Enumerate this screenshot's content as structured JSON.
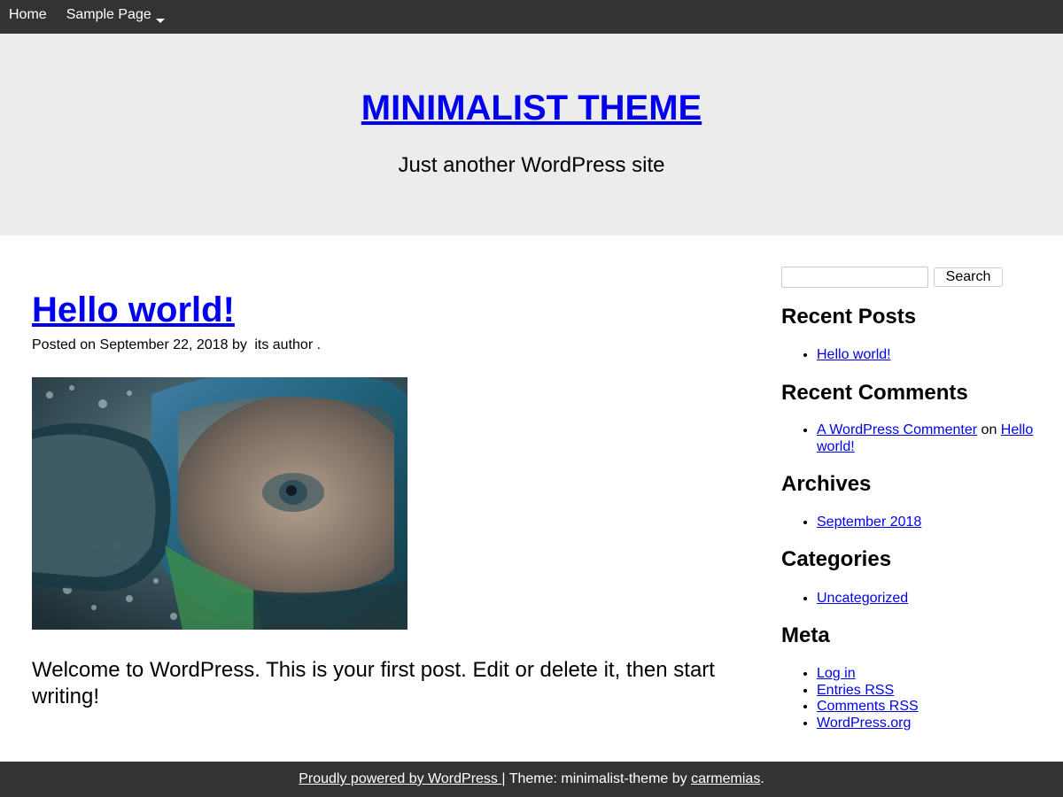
{
  "nav": {
    "items": [
      {
        "label": "Home"
      },
      {
        "label": "Sample Page",
        "has_dropdown": true
      }
    ]
  },
  "header": {
    "title": "MINIMALIST THEME",
    "description": "Just another WordPress site"
  },
  "post": {
    "title": "Hello world!",
    "meta_prefix": "Posted on",
    "date": "September 22, 2018",
    "by": "by",
    "author": "its author",
    "meta_suffix": ".",
    "content": "Welcome to WordPress. This is your first post. Edit or delete it, then start writing!"
  },
  "sidebar": {
    "search": {
      "placeholder": "",
      "button_label": "Search"
    },
    "recent_posts": {
      "title": "Recent Posts",
      "items": [
        "Hello world!"
      ]
    },
    "recent_comments": {
      "title": "Recent Comments",
      "commenter": "A WordPress Commenter",
      "on": "on",
      "post": "Hello world!"
    },
    "archives": {
      "title": "Archives",
      "items": [
        "September 2018"
      ]
    },
    "categories": {
      "title": "Categories",
      "items": [
        "Uncategorized"
      ]
    },
    "meta": {
      "title": "Meta",
      "items": [
        "Log in",
        "Entries RSS",
        "Comments RSS",
        "WordPress.org"
      ]
    }
  },
  "footer": {
    "powered_link": "Proudly powered by WordPress ",
    "separator": "| Theme: minimalist-theme by ",
    "author_link": "carmemias",
    "suffix": "."
  },
  "colors": {
    "nav_bg": "#333333",
    "header_bg": "#ececec",
    "link": "#0000ee"
  }
}
